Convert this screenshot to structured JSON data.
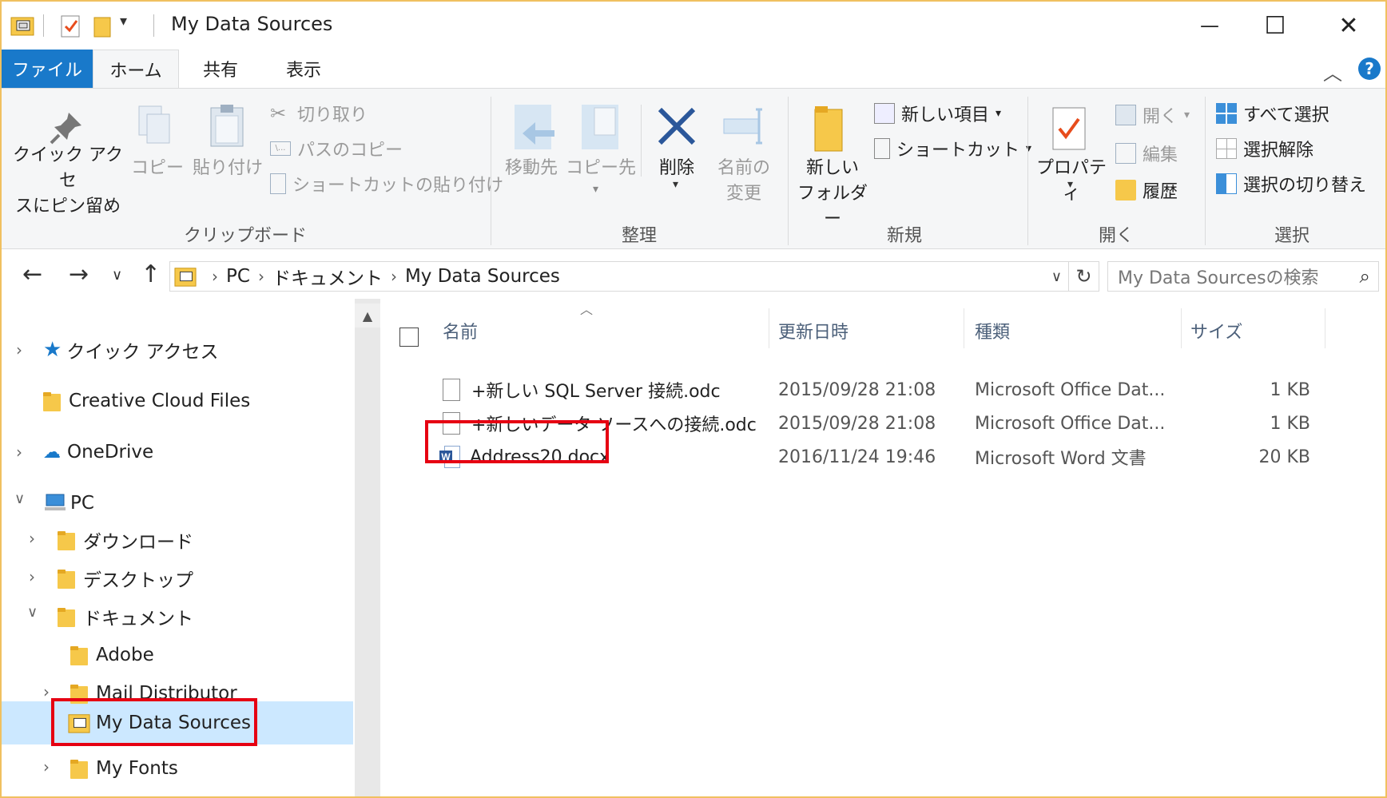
{
  "window": {
    "title": "My Data Sources",
    "minimize": "—",
    "maximize": "☐",
    "close": "✕"
  },
  "tabs": {
    "file": "ファイル",
    "home": "ホーム",
    "share": "共有",
    "view": "表示",
    "collapse": "︿",
    "help": "?"
  },
  "ribbon": {
    "clipboard": {
      "label": "クリップボード",
      "pin_line1": "クイック アクセ",
      "pin_line2": "スにピン留め",
      "copy": "コピー",
      "paste": "貼り付け",
      "cut": "切り取り",
      "copy_path": "パスのコピー",
      "paste_shortcut": "ショートカットの貼り付け"
    },
    "organize": {
      "label": "整理",
      "move_to": "移動先",
      "copy_to": "コピー先",
      "delete": "削除",
      "rename_line1": "名前の",
      "rename_line2": "変更"
    },
    "new": {
      "label": "新規",
      "new_folder_line1": "新しい",
      "new_folder_line2": "フォルダー",
      "new_item": "新しい項目",
      "shortcut": "ショートカット"
    },
    "open": {
      "label": "開く",
      "properties": "プロパティ",
      "open": "開く",
      "edit": "編集",
      "history": "履歴"
    },
    "select": {
      "label": "選択",
      "select_all": "すべて選択",
      "select_none": "選択解除",
      "invert": "選択の切り替え"
    }
  },
  "address": {
    "crumbs": [
      "PC",
      "ドキュメント",
      "My Data Sources"
    ],
    "search_placeholder": "My Data Sourcesの検索"
  },
  "nav": {
    "quick_access": "クイック アクセス",
    "creative_cloud": "Creative Cloud Files",
    "onedrive": "OneDrive",
    "pc": "PC",
    "downloads": "ダウンロード",
    "desktop": "デスクトップ",
    "documents": "ドキュメント",
    "adobe": "Adobe",
    "mail_distributor": "Mail Distributor",
    "my_data_sources": "My Data Sources",
    "my_fonts": "My Fonts"
  },
  "filelist": {
    "columns": {
      "name": "名前",
      "modified": "更新日時",
      "type": "種類",
      "size": "サイズ"
    },
    "files": [
      {
        "name": "+新しい SQL Server 接続.odc",
        "modified": "2015/09/28 21:08",
        "type": "Microsoft Office Dat...",
        "size": "1 KB"
      },
      {
        "name": "+新しいデータ ソースへの接続.odc",
        "modified": "2015/09/28 21:08",
        "type": "Microsoft Office Dat...",
        "size": "1 KB"
      },
      {
        "name": "Address20.docx",
        "modified": "2016/11/24 19:46",
        "type": "Microsoft Word 文書",
        "size": "20 KB"
      }
    ]
  },
  "colors": {
    "accent": "#1979ca",
    "selection": "#cce8ff",
    "highlight_box": "#e60012"
  }
}
